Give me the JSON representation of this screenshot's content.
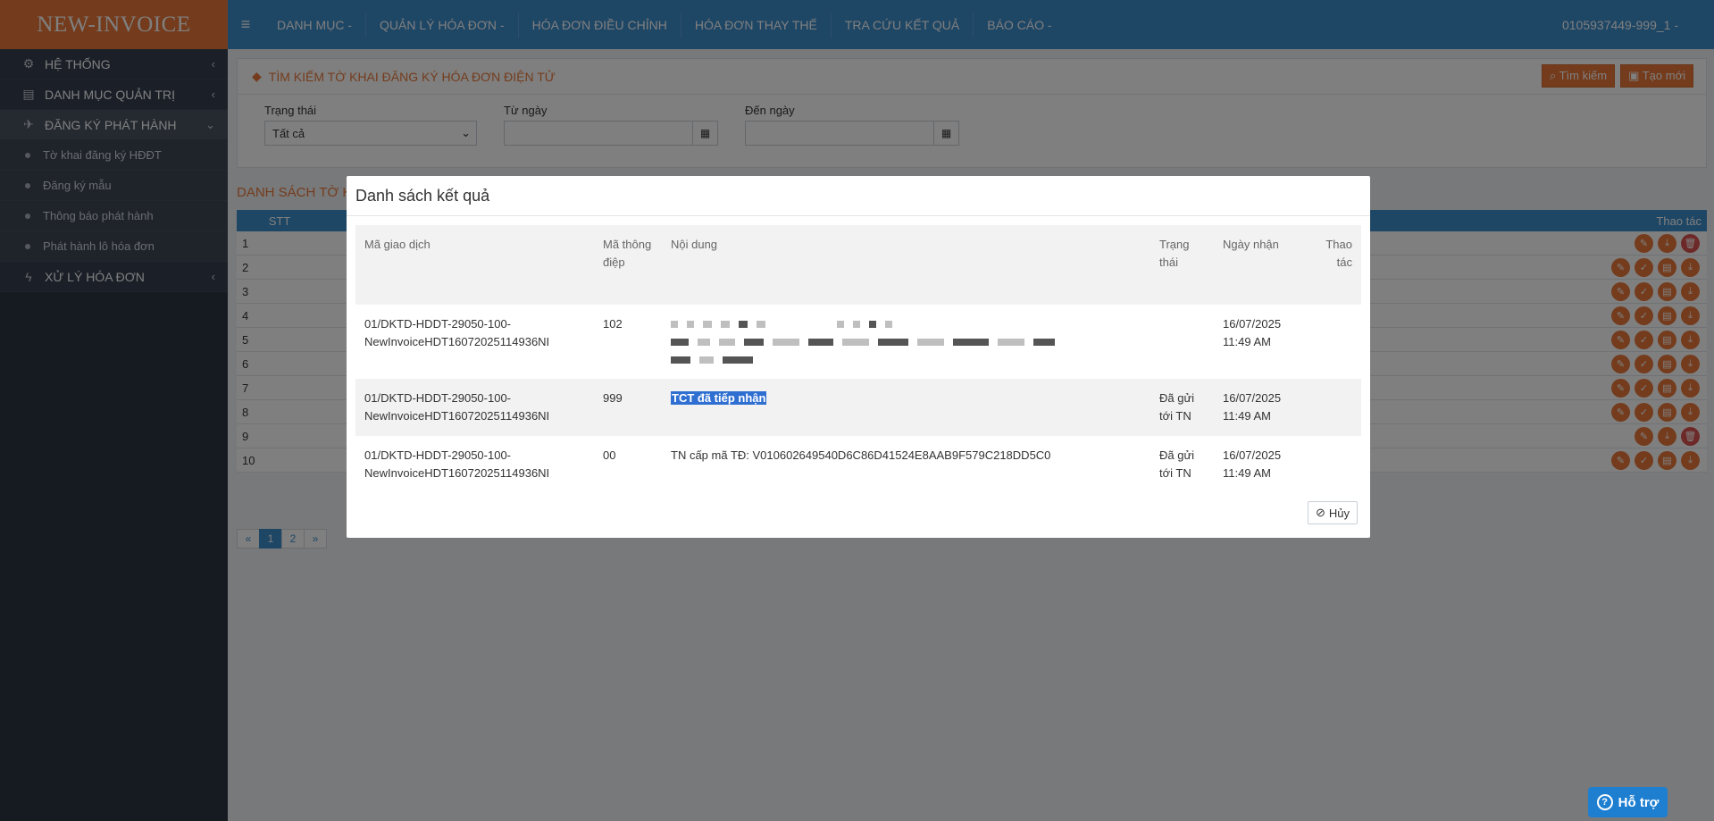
{
  "app": {
    "logo": "NEW-INVOICE",
    "user": "0105937449-999_1 -"
  },
  "topmenu": [
    {
      "label": "DANH MỤC -"
    },
    {
      "label": "QUẢN LÝ HÓA ĐƠN -"
    },
    {
      "label": "HÓA ĐƠN ĐIỀU CHỈNH"
    },
    {
      "label": "HÓA ĐƠN THAY THẾ"
    },
    {
      "label": "TRA CỨU KẾT QUẢ"
    },
    {
      "label": "BÁO CÁO -"
    }
  ],
  "sidebar": {
    "items": [
      {
        "label": "HỆ THỐNG",
        "icon": "gears-icon"
      },
      {
        "label": "DANH MỤC QUẢN TRỊ",
        "icon": "document-icon"
      },
      {
        "label": "ĐĂNG KÝ PHÁT HÀNH",
        "icon": "plane-icon"
      },
      {
        "label": "XỬ LÝ HÓA ĐƠN",
        "icon": "bolt-icon"
      }
    ],
    "subitems": [
      {
        "label": "Tờ khai đăng ký HĐĐT"
      },
      {
        "label": "Đăng ký mẫu"
      },
      {
        "label": "Thông báo phát hành"
      },
      {
        "label": "Phát hành lô hóa đơn"
      }
    ]
  },
  "search": {
    "title": "TÌM KIẾM TỜ KHAI ĐĂNG KÝ HÓA ĐƠN ĐIỆN TỬ",
    "btn_search": "Tìm kiếm",
    "btn_new": "Tạo mới",
    "status_label": "Trạng thái",
    "status_value": "Tất cả",
    "from_label": "Từ ngày",
    "to_label": "Đến ngày"
  },
  "list": {
    "title": "DANH SÁCH TỜ K",
    "col_stt": "STT",
    "col_actions": "Thao tác",
    "rows": [
      "1",
      "2",
      "3",
      "4",
      "5",
      "6",
      "7",
      "8",
      "9",
      "10"
    ]
  },
  "pager": [
    "«",
    "1",
    "2",
    "»"
  ],
  "modal": {
    "title": "Danh sách kết quả",
    "headers": {
      "code": "Mã giao dịch",
      "msg": "Mã thông điệp",
      "content": "Nội dung",
      "status": "Trạng thái",
      "date": "Ngày nhận",
      "action": "Thao tác"
    },
    "rows": [
      {
        "code": "01/DKTD-HDDT-29050-100-NewInvoiceHDT16072025114936NI",
        "msg": "102",
        "content": "",
        "status": "",
        "date": "16/07/2025 11:49 AM"
      },
      {
        "code": "01/DKTD-HDDT-29050-100-NewInvoiceHDT16072025114936NI",
        "msg": "999",
        "content": "TCT đã tiếp nhận",
        "status": "Đã gửi tới TN",
        "date": "16/07/2025 11:49 AM"
      },
      {
        "code": "01/DKTD-HDDT-29050-100-NewInvoiceHDT16072025114936NI",
        "msg": "00",
        "content": "TN cấp mã TĐ: V010602649540D6C86D41524E8AAB9F579C218DD5C0",
        "status": "Đã gửi tới TN",
        "date": "16/07/2025 11:49 AM"
      }
    ],
    "cancel_label": "Hủy"
  },
  "help": {
    "label": "Hỗ trợ"
  },
  "colors": {
    "brand_orange": "#e8793a",
    "topbar_blue": "#3d8ccb",
    "sidebar_dark": "#2b3643",
    "highlight": "#2f6fd1"
  }
}
